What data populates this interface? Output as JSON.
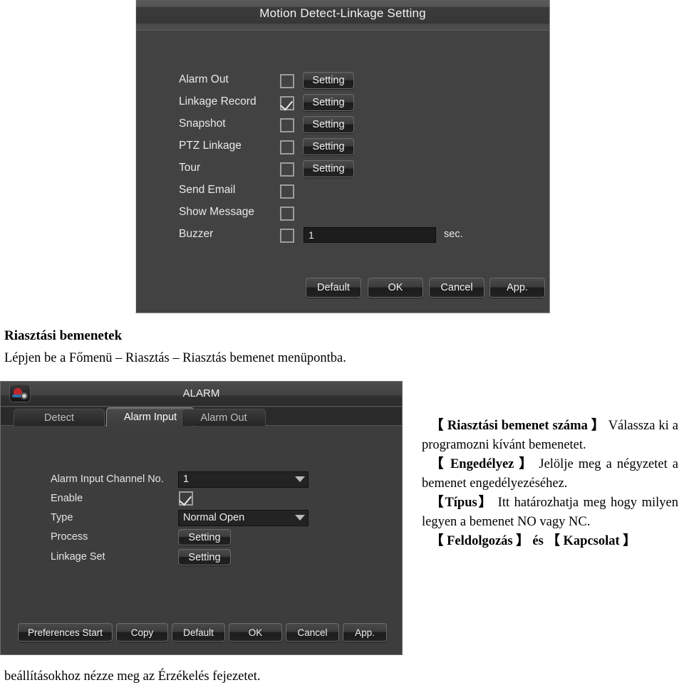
{
  "motion_dialog": {
    "title": "Motion Detect-Linkage Setting",
    "rows": [
      {
        "label": "Alarm Out",
        "checked": false,
        "button": "Setting"
      },
      {
        "label": "Linkage Record",
        "checked": true,
        "button": "Setting"
      },
      {
        "label": "Snapshot",
        "checked": false,
        "button": "Setting"
      },
      {
        "label": "PTZ Linkage",
        "checked": false,
        "button": "Setting"
      },
      {
        "label": "Tour",
        "checked": false,
        "button": "Setting"
      },
      {
        "label": "Send Email",
        "checked": false,
        "button": ""
      },
      {
        "label": "Show Message",
        "checked": false,
        "button": ""
      },
      {
        "label": "Buzzer",
        "checked": false,
        "button": ""
      }
    ],
    "buzzer_value": "1",
    "buzzer_unit": "sec.",
    "footer_buttons": [
      "Default",
      "OK",
      "Cancel",
      "App."
    ]
  },
  "alarm_panel": {
    "title": "ALARM",
    "icon": "alarm-camera-gear-icon",
    "tabs": [
      {
        "label": "Detect",
        "active": false
      },
      {
        "label": "Alarm Input",
        "active": true
      },
      {
        "label": "Alarm Out",
        "active": false
      }
    ],
    "fields": {
      "channel_label": "Alarm Input Channel No.",
      "channel_value": "1",
      "enable_label": "Enable",
      "enable_checked": true,
      "type_label": "Type",
      "type_value": "Normal Open",
      "process_label": "Process",
      "process_button": "Setting",
      "linkage_label": "Linkage Set",
      "linkage_button": "Setting"
    },
    "footer_buttons": [
      "Preferences Start",
      "Copy",
      "Default",
      "OK",
      "Cancel",
      "App."
    ]
  },
  "document": {
    "heading": "Riasztási bemenetek",
    "intro": "Lépjen be a Főmenü – Riasztás – Riasztás bemenet menüpontba.",
    "bottom_line": "beállításokhoz nézze meg az Érzékelés fejezetet.",
    "paragraphs": [
      {
        "term": "【 Riasztási bemenet száma 】",
        "body": "Válassza ki a programozni kívánt bemenetet."
      },
      {
        "term": "【 Engedélyez 】",
        "body": "Jelölje meg a négyzetet a bemenet engedélyezéséhez."
      },
      {
        "term": "【Típus】",
        "body": "Itt határozhatja meg hogy milyen legyen a bemenet NO vagy NC."
      },
      {
        "term": "【 Feldolgozás 】 és 【 Kapcsolat 】",
        "body": ""
      }
    ]
  },
  "colors": {
    "dialog_bg": "#424242",
    "panel_bg": "#3d3d3d",
    "text": "#e9e9e9",
    "page_bg": "#ffffff"
  }
}
